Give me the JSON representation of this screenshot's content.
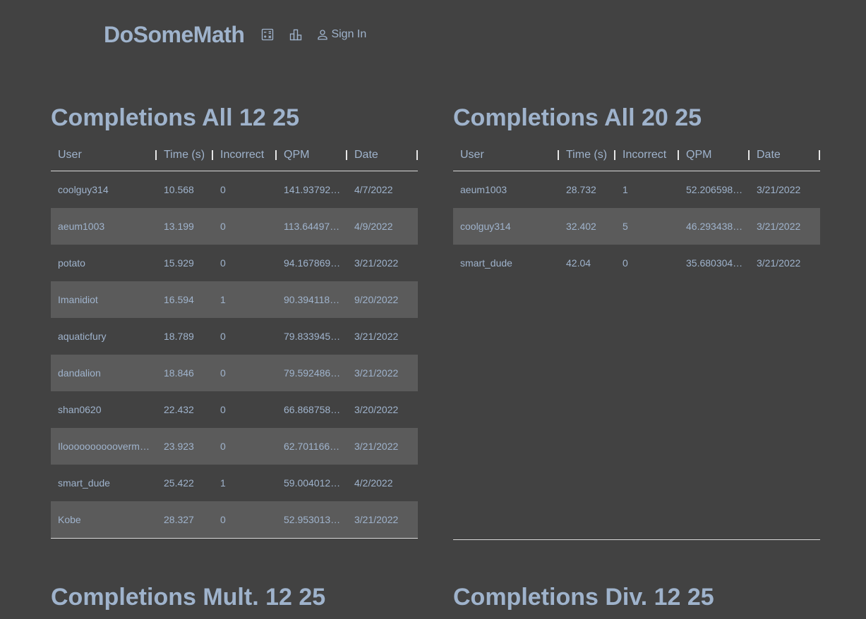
{
  "header": {
    "logo": "DoSomeMath",
    "icons": [
      "calculator-icon",
      "leaderboard-icon",
      "person-icon"
    ],
    "signin_label": "Sign In"
  },
  "columns": [
    "User",
    "Time (s)",
    "Incorrect",
    "QPM",
    "Date"
  ],
  "tables": [
    {
      "title": "Completions All 12 25",
      "rows": [
        [
          "coolguy314",
          "10.568",
          "0",
          "141.93792…",
          "4/7/2022"
        ],
        [
          "aeum1003",
          "13.199",
          "0",
          "113.64497…",
          "4/9/2022"
        ],
        [
          "potato",
          "15.929",
          "0",
          "94.167869…",
          "3/21/2022"
        ],
        [
          "Imanidiot",
          "16.594",
          "1",
          "90.394118…",
          "9/20/2022"
        ],
        [
          "aquaticfury",
          "18.789",
          "0",
          "79.833945…",
          "3/21/2022"
        ],
        [
          "dandalion",
          "18.846",
          "0",
          "79.592486…",
          "3/21/2022"
        ],
        [
          "shan0620",
          "22.432",
          "0",
          "66.868758…",
          "3/20/2022"
        ],
        [
          "Ilooooooooooverm…",
          "23.923",
          "0",
          "62.701166…",
          "3/21/2022"
        ],
        [
          "smart_dude",
          "25.422",
          "1",
          "59.004012…",
          "4/2/2022"
        ],
        [
          "Kobe",
          "28.327",
          "0",
          "52.953013…",
          "3/21/2022"
        ]
      ]
    },
    {
      "title": "Completions All 20 25",
      "rows": [
        [
          "aeum1003",
          "28.732",
          "1",
          "52.206598…",
          "3/21/2022"
        ],
        [
          "coolguy314",
          "32.402",
          "5",
          "46.293438…",
          "3/21/2022"
        ],
        [
          "smart_dude",
          "42.04",
          "0",
          "35.680304…",
          "3/21/2022"
        ]
      ]
    }
  ],
  "lower_titles": [
    "Completions Mult. 12 25",
    "Completions Div. 12 25"
  ]
}
